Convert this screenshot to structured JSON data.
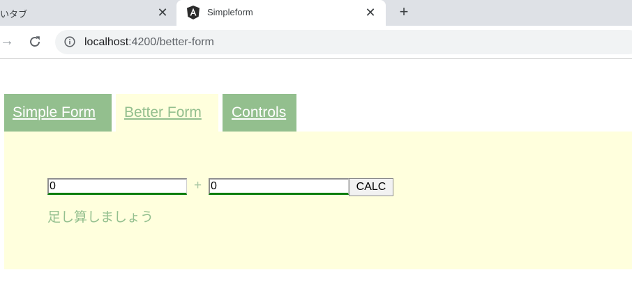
{
  "browser": {
    "inactive_tab_title": "いタブ",
    "active_tab_title": "Simpleform",
    "close_glyph": "✕",
    "new_tab_glyph": "+",
    "forward_glyph": "→",
    "url_host": "localhost",
    "url_path": ":4200/better-form"
  },
  "nav": {
    "tabs": [
      {
        "label": "Simple Form ",
        "active": false
      },
      {
        "label": "Better Form ",
        "active": true
      },
      {
        "label": "Controls",
        "active": false
      }
    ]
  },
  "form": {
    "first_value": "0",
    "plus": "+",
    "second_value": "0",
    "calc_label": "CALC",
    "message": "足し算しましょう"
  },
  "colors": {
    "nav_inactive_bg": "#93bf8e",
    "panel_bg": "#ffffdd",
    "text_green": "#93bf8e",
    "input_underline": "#0a7d0a"
  }
}
